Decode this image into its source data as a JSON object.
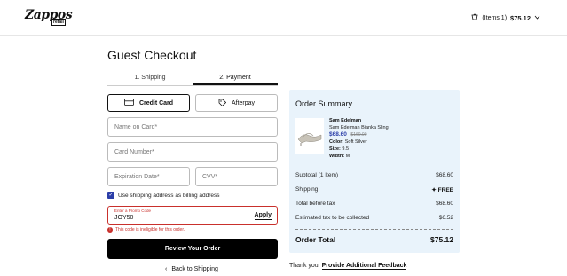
{
  "header": {
    "logo_text": "Zappos",
    "logo_sub": "retail",
    "cart_count": "(Items 1)",
    "cart_total": "$75.12"
  },
  "page_title": "Guest Checkout",
  "tabs": [
    {
      "label": "1. Shipping",
      "active": false
    },
    {
      "label": "2. Payment",
      "active": true
    }
  ],
  "payment_methods": [
    {
      "label": "Credit Card",
      "icon": "credit-card-icon",
      "selected": true
    },
    {
      "label": "Afterpay",
      "icon": "tag-icon",
      "selected": false
    }
  ],
  "fields": {
    "name_placeholder": "Name on Card*",
    "number_placeholder": "Card Number*",
    "expiration_placeholder": "Expiration Date*",
    "cvv_placeholder": "CVV*"
  },
  "billing_checkbox": {
    "label": "Use shipping address as billing address",
    "checked": true
  },
  "promo": {
    "label": "Enter a Promo Code",
    "value": "JOY50",
    "apply_label": "Apply",
    "error": "This code is ineligible for this order."
  },
  "review_button": "Review Your Order",
  "back_link": "Back to Shipping",
  "summary": {
    "title": "Order Summary",
    "product": {
      "brand": "Sam Edelman",
      "name": "Sam Edelman Bianka Sling",
      "price": "$68.60",
      "original_price": "$160.00",
      "color_label": "Color:",
      "color": "Soft Silver",
      "size_label": "Size:",
      "size": "9.5",
      "width_label": "Width:",
      "width": "M"
    },
    "rows": [
      {
        "label": "Subtotal (1 Item)",
        "value": "$68.60"
      },
      {
        "label": "Shipping",
        "value": "FREE"
      },
      {
        "label": "Total before tax",
        "value": "$68.60"
      },
      {
        "label": "Estimated tax to be collected",
        "value": "$6.52"
      }
    ],
    "total_label": "Order Total",
    "total_value": "$75.12"
  },
  "feedback": {
    "prefix": "Thank you!",
    "link": "Provide Additional Feedback"
  },
  "colors": {
    "accent": "#2b3ea8",
    "error": "#c9302c",
    "summary_bg": "#e9f3fb"
  }
}
